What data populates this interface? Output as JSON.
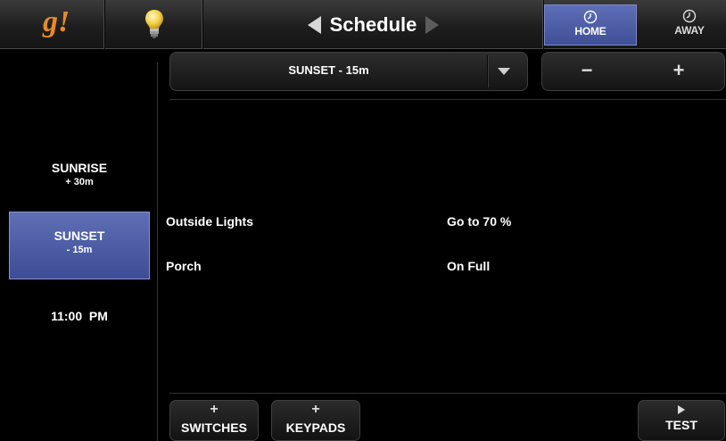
{
  "header": {
    "logo_text": "g!",
    "title": "Schedule",
    "home_label": "HOME",
    "away_label": "AWAY",
    "icons": {
      "logo": "g-logo",
      "lights": "lightbulb-icon",
      "prev": "arrow-left-icon",
      "next": "arrow-right-icon",
      "clock": "clock-icon"
    },
    "colors": {
      "logo": "#e88a25",
      "selected": "#4a5aa6"
    }
  },
  "events": [
    {
      "name": "SUNRISE",
      "offset": "+ 30m"
    },
    {
      "name": "SUNSET",
      "offset": "- 15m",
      "selected": true
    },
    {
      "name": "11:00  PM"
    }
  ],
  "event_dropdown": {
    "value": "SUNSET - 15m"
  },
  "offset_stepper": {
    "minus_label": "−",
    "plus_label": "+"
  },
  "actions": [
    {
      "device": "Outside Lights",
      "action": "Go to 70 %"
    },
    {
      "device": "Porch",
      "action": "On Full"
    }
  ],
  "footer": {
    "switches_icon": "+",
    "switches_label": "SWITCHES",
    "keypads_icon": "+",
    "keypads_label": "KEYPADS",
    "test_label": "TEST"
  }
}
